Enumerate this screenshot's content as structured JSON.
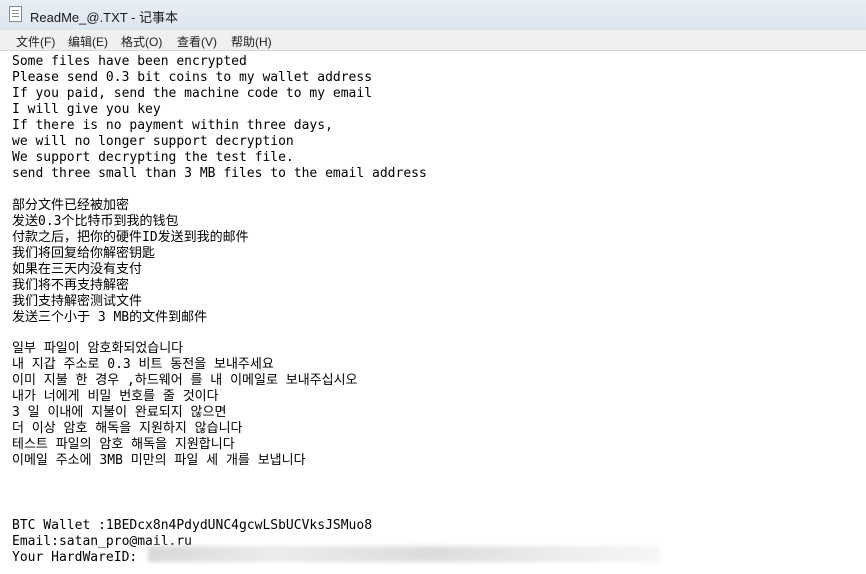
{
  "window": {
    "title": "ReadMe_@.TXT - 记事本",
    "icon": "notepad-icon"
  },
  "menu": [
    {
      "label": "文件(F)"
    },
    {
      "label": "编辑(E)"
    },
    {
      "label": "格式(O)"
    },
    {
      "label": "查看(V)"
    },
    {
      "label": "帮助(H)"
    }
  ],
  "document": {
    "english": [
      "Some files have been encrypted",
      "Please send 0.3 bit coins to my wallet address",
      "If you paid, send the machine code to my email",
      "I will give you key",
      "If there is no payment within three days,",
      "we will no longer support decryption",
      "We support decrypting the test file.",
      "send three small than 3 MB files to the email address"
    ],
    "chinese": [
      "部分文件已经被加密",
      "发送0.3个比特币到我的钱包",
      "付款之后，把你的硬件ID发送到我的邮件",
      "我们将回复给你解密钥匙",
      "如果在三天内没有支付",
      "我们将不再支持解密",
      "我们支持解密测试文件",
      "发送三个小于 3 MB的文件到邮件"
    ],
    "korean": [
      "일부 파일이 암호화되었습니다",
      "내 지갑 주소로 0.3 비트 동전을 보내주세요",
      "이미 지불 한 경우 ,하드웨어 를 내 이메일로 보내주십시오",
      "내가 너에게 비밀 번호를 줄 것이다",
      "3 일 이내에 지불이 완료되지 않으면",
      "더 이상 암호 해독을 지원하지 않습니다",
      "테스트 파일의 암호 해독을 지원합니다",
      "이메일 주소에 3MB 미만의 파일 세 개를 보냅니다"
    ],
    "btc_wallet": "BTC Wallet :1BEDcx8n4PdydUNC4gcwLSbUCVksJSMuo8",
    "email": "Email:satan_pro@mail.ru",
    "hardware_id_label": "Your HardWareID:"
  }
}
